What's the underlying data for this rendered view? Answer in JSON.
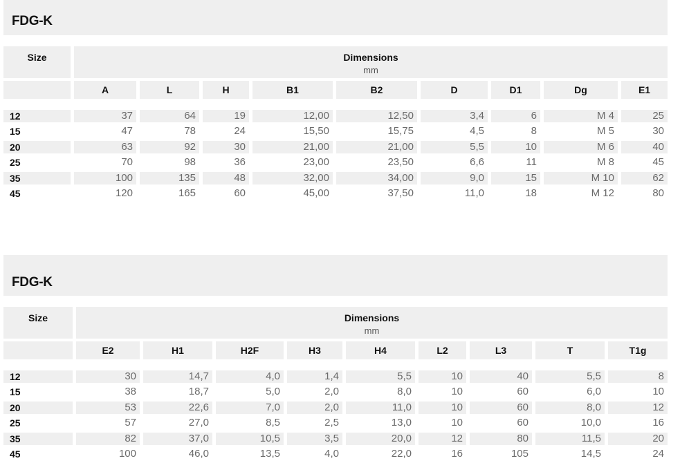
{
  "tables": [
    {
      "title": "FDG-K",
      "size_header": "Size",
      "group_header": "Dimensions",
      "unit": "mm",
      "columns": [
        "A",
        "L",
        "H",
        "B1",
        "B2",
        "D",
        "D1",
        "Dg",
        "E1"
      ],
      "rows": [
        {
          "size": "12",
          "values": [
            "37",
            "64",
            "19",
            "12,00",
            "12,50",
            "3,4",
            "6",
            "M 4",
            "25"
          ]
        },
        {
          "size": "15",
          "values": [
            "47",
            "78",
            "24",
            "15,50",
            "15,75",
            "4,5",
            "8",
            "M 5",
            "30"
          ]
        },
        {
          "size": "20",
          "values": [
            "63",
            "92",
            "30",
            "21,00",
            "21,00",
            "5,5",
            "10",
            "M 6",
            "40"
          ]
        },
        {
          "size": "25",
          "values": [
            "70",
            "98",
            "36",
            "23,00",
            "23,50",
            "6,6",
            "11",
            "M 8",
            "45"
          ]
        },
        {
          "size": "35",
          "values": [
            "100",
            "135",
            "48",
            "32,00",
            "34,00",
            "9,0",
            "15",
            "M 10",
            "62"
          ]
        },
        {
          "size": "45",
          "values": [
            "120",
            "165",
            "60",
            "45,00",
            "37,50",
            "11,0",
            "18",
            "M 12",
            "80"
          ]
        }
      ]
    },
    {
      "title": "FDG-K",
      "size_header": "Size",
      "group_header": "Dimensions",
      "unit": "mm",
      "columns": [
        "E2",
        "H1",
        "H2F",
        "H3",
        "H4",
        "L2",
        "L3",
        "T",
        "T1g"
      ],
      "rows": [
        {
          "size": "12",
          "values": [
            "30",
            "14,7",
            "4,0",
            "1,4",
            "5,5",
            "10",
            "40",
            "5,5",
            "8"
          ]
        },
        {
          "size": "15",
          "values": [
            "38",
            "18,7",
            "5,0",
            "2,0",
            "8,0",
            "10",
            "60",
            "6,0",
            "10"
          ]
        },
        {
          "size": "20",
          "values": [
            "53",
            "22,6",
            "7,0",
            "2,0",
            "11,0",
            "10",
            "60",
            "8,0",
            "12"
          ]
        },
        {
          "size": "25",
          "values": [
            "57",
            "27,0",
            "8,5",
            "2,5",
            "13,0",
            "10",
            "60",
            "10,0",
            "16"
          ]
        },
        {
          "size": "35",
          "values": [
            "82",
            "37,0",
            "10,5",
            "3,5",
            "20,0",
            "12",
            "80",
            "11,5",
            "20"
          ]
        },
        {
          "size": "45",
          "values": [
            "100",
            "46,0",
            "13,5",
            "4,0",
            "22,0",
            "16",
            "105",
            "14,5",
            "24"
          ]
        }
      ]
    }
  ]
}
